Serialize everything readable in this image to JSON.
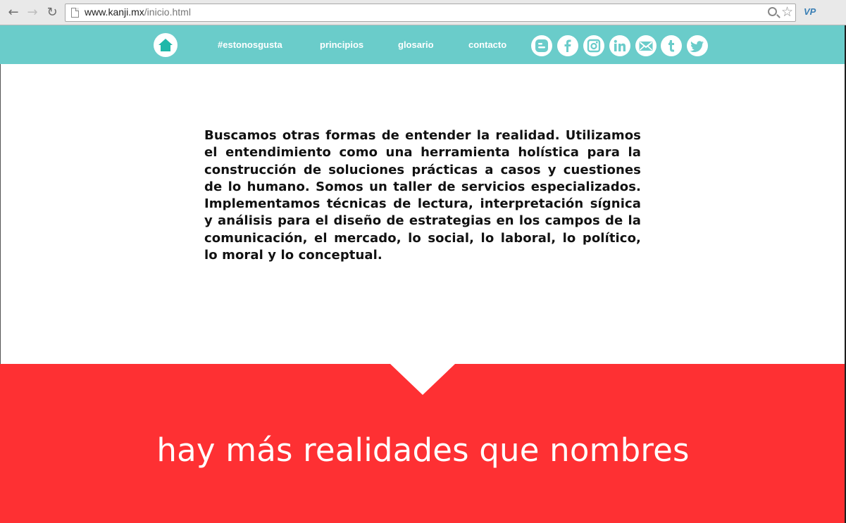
{
  "browser": {
    "url_host": "www.kanji.mx",
    "url_path": "/inicio.html",
    "extension_label": "VP"
  },
  "site": {
    "nav": [
      {
        "label": "#estonosgusta"
      },
      {
        "label": "principios"
      },
      {
        "label": "glosario"
      },
      {
        "label": "contacto"
      }
    ],
    "social": [
      "blogger-icon",
      "facebook-icon",
      "instagram-icon",
      "linkedin-icon",
      "mail-icon",
      "tumblr-icon",
      "twitter-icon"
    ],
    "intro_text": "Buscamos otras formas de entender la realidad. Utilizamos el entendimiento como una herramienta holística para la construcción de soluciones prácticas a casos y cuestiones de lo humano. Somos un taller de servicios especializados. Implementamos técnicas de lectura, interpretación sígnica y análisis para el diseño de estrategias en los campos de la comunicación, el mercado, lo social, lo laboral, lo político, lo moral y lo conceptual.",
    "tagline": "hay más realidades que nombres"
  },
  "colors": {
    "header": "#6accca",
    "banner": "#fe3033",
    "home_icon": "#1fb8a9"
  }
}
